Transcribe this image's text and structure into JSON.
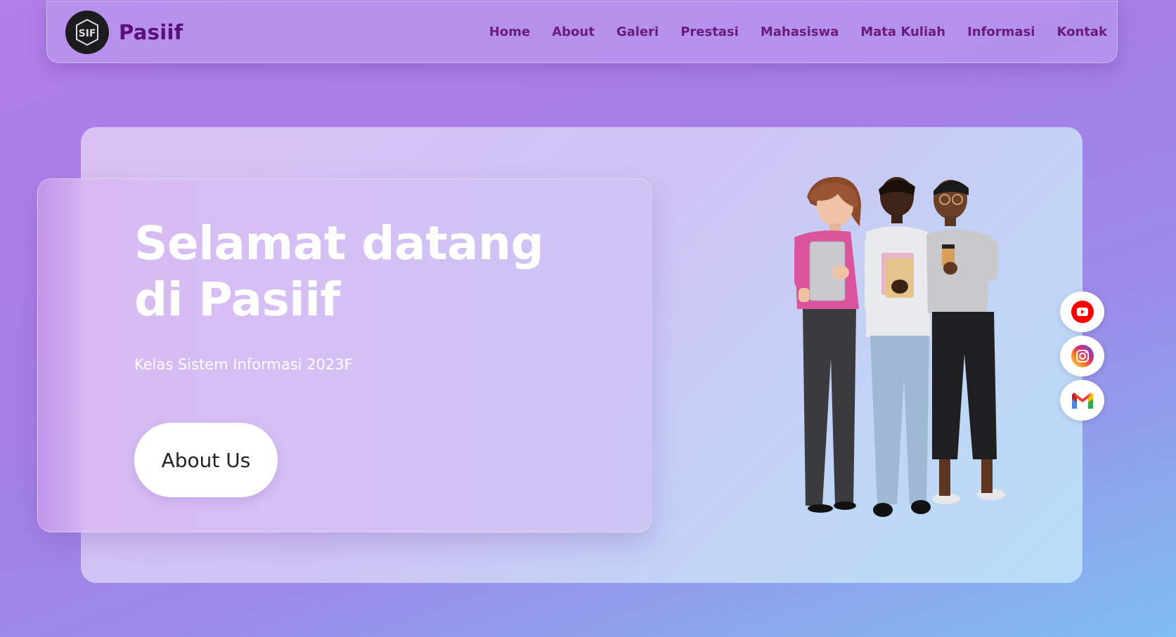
{
  "brand": {
    "name": "Pasiif",
    "logo_icon": "sif-logo-icon"
  },
  "nav": {
    "links": [
      "Home",
      "About",
      "Galeri",
      "Prestasi",
      "Mahasiswa",
      "Mata Kuliah",
      "Informasi",
      "Kontak"
    ]
  },
  "hero": {
    "title_line1": "Selamat datang",
    "title_line2": "di Pasiif",
    "subtitle": "Kelas Sistem Informasi 2023F",
    "button_label": "About Us"
  },
  "social": [
    {
      "icon": "youtube-icon",
      "color": "#ff0000"
    },
    {
      "icon": "instagram-icon",
      "color": "#d6249f"
    },
    {
      "icon": "gmail-icon",
      "color": "#ea4335"
    }
  ],
  "colors": {
    "brand": "#5a0f7a",
    "nav_text": "#6b1b7a",
    "background_start": "#b27ee8",
    "background_end": "#7fbef2"
  }
}
